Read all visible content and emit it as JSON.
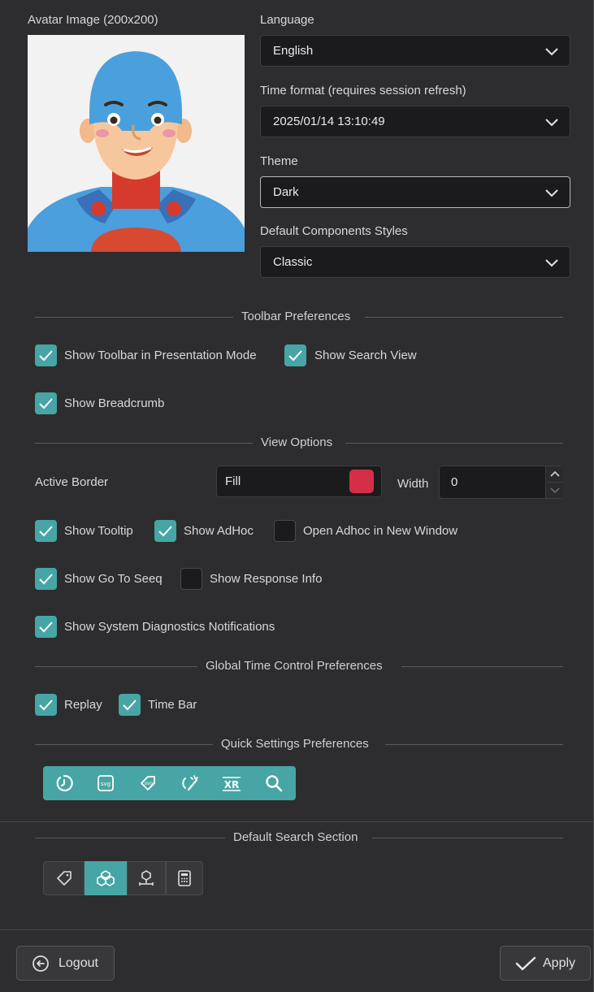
{
  "avatar": {
    "label": "Avatar Image (200x200)"
  },
  "language": {
    "label": "Language",
    "value": "English"
  },
  "time_format": {
    "label": "Time format (requires session refresh)",
    "value": "2025/01/14 13:10:49"
  },
  "theme": {
    "label": "Theme",
    "value": "Dark"
  },
  "components_styles": {
    "label": "Default Components Styles",
    "value": "Classic"
  },
  "toolbar_prefs": {
    "title": "Toolbar Preferences",
    "show_toolbar_presentation": {
      "label": "Show Toolbar in Presentation Mode",
      "checked": true
    },
    "show_search_view": {
      "label": "Show Search View",
      "checked": true
    },
    "show_breadcrumb": {
      "label": "Show Breadcrumb",
      "checked": true
    }
  },
  "view_options": {
    "title": "View Options",
    "active_border_label": "Active Border",
    "fill_value": "Fill",
    "fill_color": "#d42f47",
    "width_label": "Width",
    "width_value": "0",
    "show_tooltip": {
      "label": "Show Tooltip",
      "checked": true
    },
    "show_adhoc": {
      "label": "Show AdHoc",
      "checked": true
    },
    "open_adhoc_new_window": {
      "label": "Open Adhoc in New Window",
      "checked": false
    },
    "show_go_to_seeq": {
      "label": "Show Go To Seeq",
      "checked": true
    },
    "show_response_info": {
      "label": "Show Response Info",
      "checked": false
    },
    "show_system_diag": {
      "label": "Show System Diagnostics Notifications",
      "checked": true
    }
  },
  "global_time": {
    "title": "Global Time Control Preferences",
    "replay": {
      "label": "Replay",
      "checked": true
    },
    "time_bar": {
      "label": "Time Bar",
      "checked": true
    }
  },
  "quick_settings": {
    "title": "Quick Settings Preferences",
    "icons": [
      "timer-icon",
      "svg-export-icon",
      "svg-tag-icon",
      "pointer-magic-icon",
      "xr-icon",
      "search-icon"
    ]
  },
  "default_search": {
    "title": "Default Search Section",
    "icons": [
      "tag-icon",
      "assets-icon",
      "asset-tree-icon",
      "calculator-icon"
    ],
    "active_index": 1
  },
  "footer": {
    "logout": "Logout",
    "apply": "Apply"
  },
  "colors": {
    "accent": "#47a5a5",
    "background": "#2d2d2f",
    "field": "#1b1b1d"
  }
}
